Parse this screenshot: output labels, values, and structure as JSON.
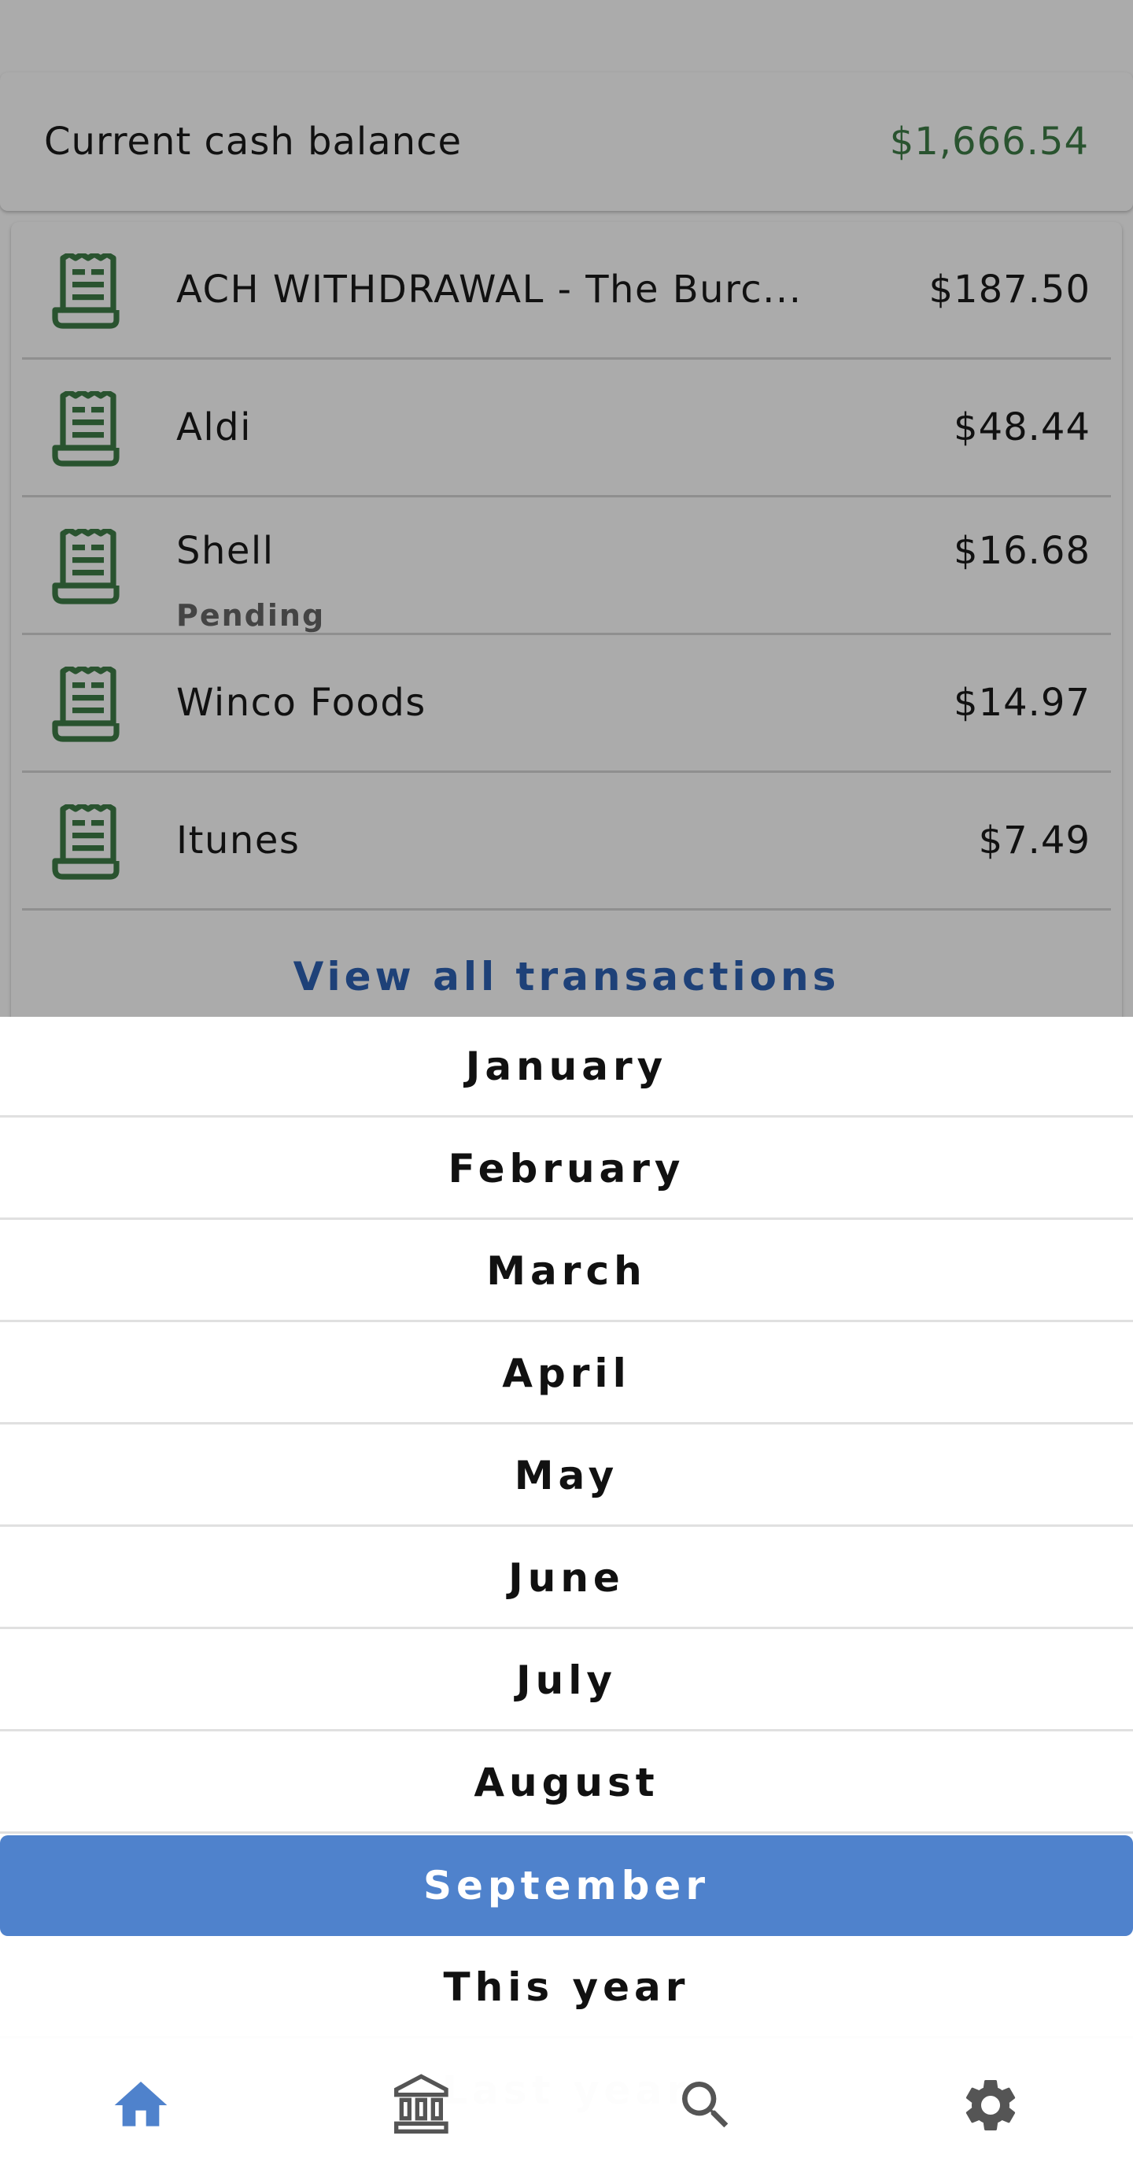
{
  "colors": {
    "accent_green": "#3e7d47",
    "accent_blue": "#4f82cc",
    "link_blue": "#2d61b3",
    "nav_inactive": "#555555"
  },
  "balance": {
    "label": "Current cash balance",
    "value": "$1,666.54"
  },
  "transactions": [
    {
      "name": "ACH WITHDRAWAL - The Burc...",
      "amount": "$187.50",
      "status": "",
      "icon": "receipt-icon"
    },
    {
      "name": "Aldi",
      "amount": "$48.44",
      "status": "",
      "icon": "receipt-icon"
    },
    {
      "name": "Shell",
      "amount": "$16.68",
      "status": "Pending",
      "icon": "receipt-icon"
    },
    {
      "name": "Winco Foods",
      "amount": "$14.97",
      "status": "",
      "icon": "receipt-icon"
    },
    {
      "name": "Itunes",
      "amount": "$7.49",
      "status": "",
      "icon": "receipt-icon"
    }
  ],
  "view_all_label": "View all transactions",
  "period_picker": {
    "options": [
      "January",
      "February",
      "March",
      "April",
      "May",
      "June",
      "July",
      "August",
      "September",
      "This year",
      "Last year"
    ],
    "selected": "September"
  },
  "bottom_nav": [
    {
      "icon": "home-icon",
      "active": true
    },
    {
      "icon": "bank-icon",
      "active": false
    },
    {
      "icon": "search-icon",
      "active": false
    },
    {
      "icon": "settings-gear-icon",
      "active": false
    }
  ]
}
